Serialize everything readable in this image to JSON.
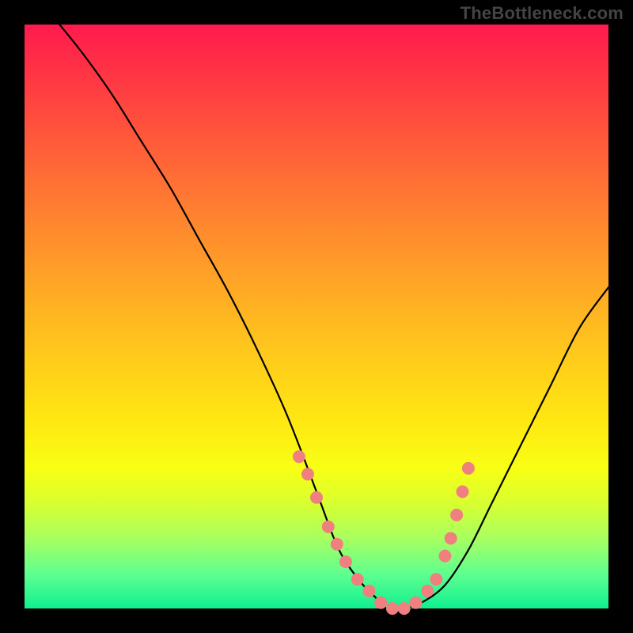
{
  "watermark": "TheBottleneck.com",
  "chart_data": {
    "type": "line",
    "title": "",
    "xlabel": "",
    "ylabel": "",
    "xlim": [
      0,
      100
    ],
    "ylim": [
      0,
      100
    ],
    "series": [
      {
        "name": "bottleneck-curve",
        "x": [
          6,
          10,
          15,
          20,
          25,
          30,
          35,
          40,
          45,
          50,
          53,
          55,
          58,
          60,
          62,
          65,
          68,
          72,
          76,
          80,
          85,
          90,
          95,
          100
        ],
        "y": [
          100,
          95,
          88,
          80,
          72,
          63,
          54,
          44,
          33,
          20,
          12,
          8,
          4,
          2,
          0,
          0,
          1,
          4,
          10,
          18,
          28,
          38,
          48,
          55
        ]
      }
    ],
    "markers": {
      "name": "highlight-dots",
      "color": "#f08080",
      "x": [
        47,
        48.5,
        50,
        52,
        53.5,
        55,
        57,
        59,
        61,
        63,
        65,
        67,
        69,
        70.5,
        72,
        73,
        74,
        75,
        76
      ],
      "y": [
        26,
        23,
        19,
        14,
        11,
        8,
        5,
        3,
        1,
        0,
        0,
        1,
        3,
        5,
        9,
        12,
        16,
        20,
        24
      ]
    }
  }
}
